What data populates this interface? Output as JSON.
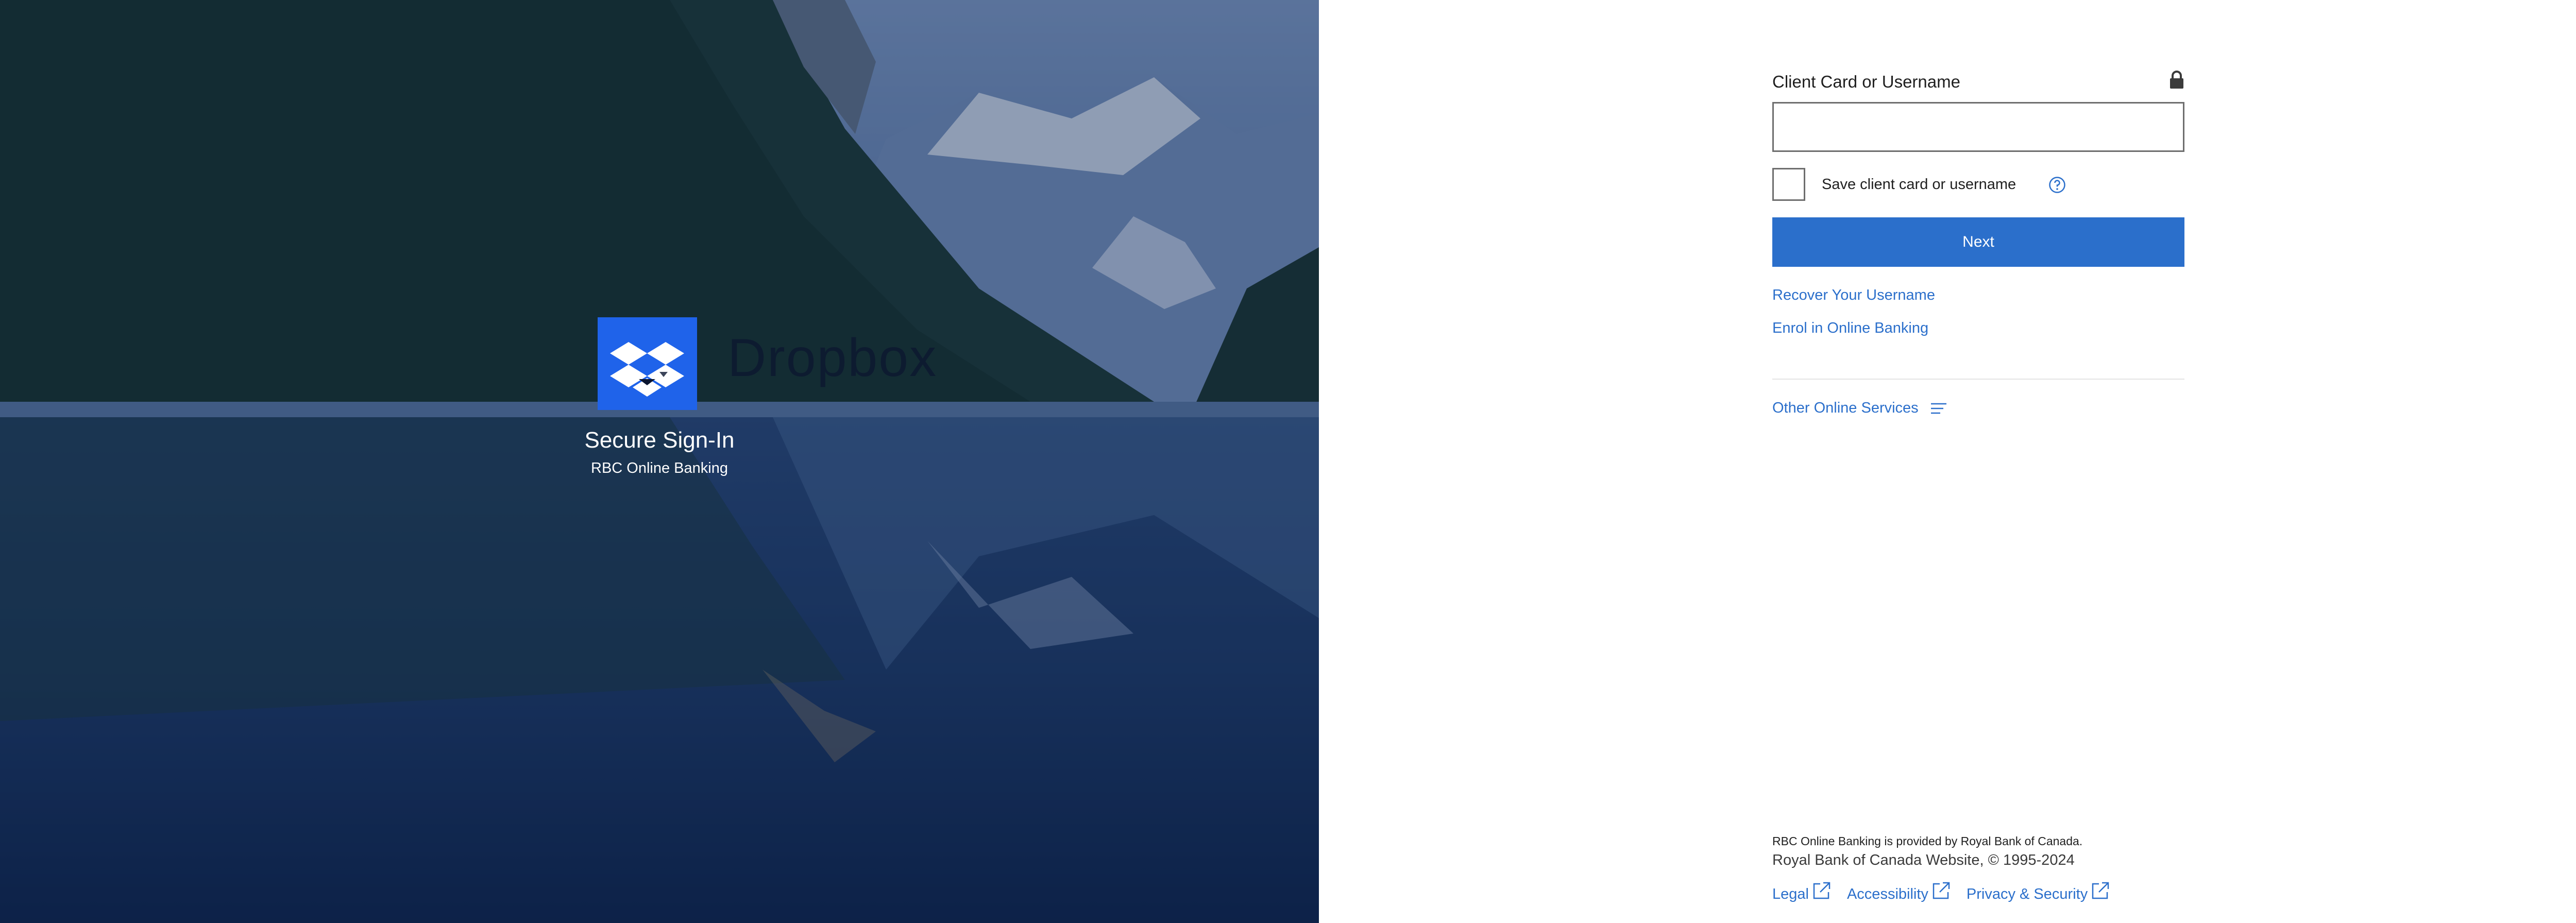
{
  "hero": {
    "brand_word": "Dropbox",
    "title": "Secure Sign-In",
    "subtitle": "RBC Online Banking"
  },
  "form": {
    "field_label": "Client Card or Username",
    "field_value": "",
    "checkbox_label": "Save client card or username",
    "checkbox_checked": false,
    "next_label": "Next",
    "recover_label": "Recover Your Username",
    "enrol_label": "Enrol in Online Banking",
    "other_services_label": "Other Online Services"
  },
  "footer": {
    "note": "RBC Online Banking is provided by Royal Bank of Canada.",
    "copyright": "Royal Bank of Canada Website, © 1995-2024",
    "links": [
      "Legal",
      "Accessibility",
      "Privacy & Security"
    ]
  },
  "icons": {
    "lock": "lock-icon",
    "help": "help-icon",
    "menu": "menu-lines-icon",
    "external": "external-link-icon",
    "logo": "dropbox-logo-icon"
  },
  "colors": {
    "accent": "#2b6fcb",
    "logo_tile": "#1f63ea",
    "hero_dark": "#0f2446"
  }
}
